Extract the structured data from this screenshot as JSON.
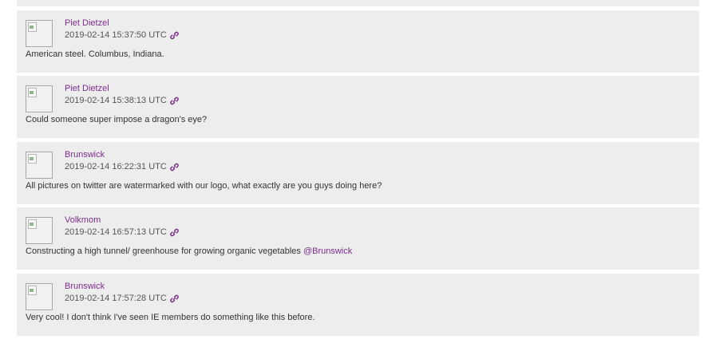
{
  "comments": [
    {
      "author": "Piet Dietzel",
      "timestamp": "2019-02-14 15:37:50 UTC",
      "text": "American steel. Columbus, Indiana.",
      "mention": ""
    },
    {
      "author": "Piet Dietzel",
      "timestamp": "2019-02-14 15:38:13 UTC",
      "text": "Could someone super impose a dragon's eye?",
      "mention": ""
    },
    {
      "author": "Brunswick",
      "timestamp": "2019-02-14 16:22:31 UTC",
      "text": "All pictures on twitter are watermarked with our logo, what exactly are you guys doing here?",
      "mention": ""
    },
    {
      "author": "Volkmom",
      "timestamp": "2019-02-14 16:57:13 UTC",
      "text": "Constructing a high tunnel/ greenhouse for growing organic vegetables ",
      "mention": "@Brunswick"
    },
    {
      "author": "Brunswick",
      "timestamp": "2019-02-14 17:57:28 UTC",
      "text": "Very cool! I don't think I've seen IE members do something like this before.",
      "mention": ""
    }
  ],
  "colors": {
    "card_background": "#ededed",
    "author_link": "#7b2d8b",
    "permalink_icon": "#7b2d8b"
  },
  "icons": {
    "permalink": "link-icon",
    "avatar": "broken-image-icon"
  }
}
